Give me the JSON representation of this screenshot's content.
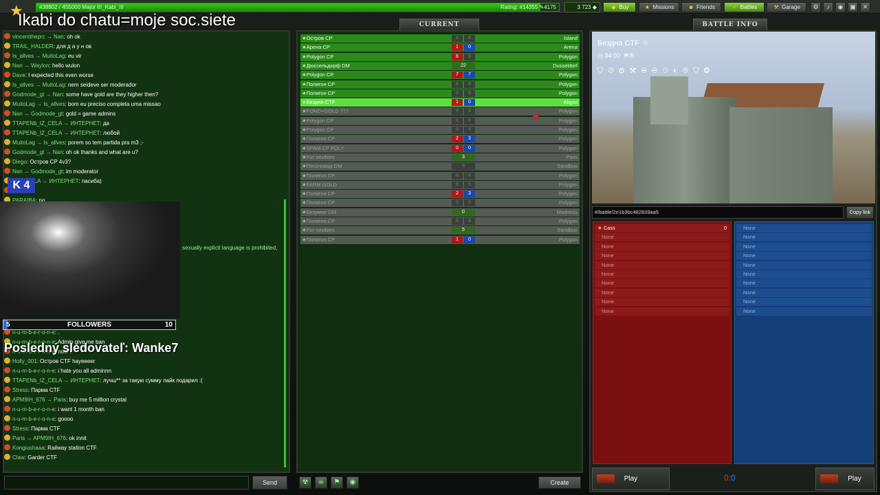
{
  "topbar": {
    "xp_text": "438802 / 455000  Major III_Kabi_III",
    "xp_progress": 0.964,
    "rating": "Rating: #14355  ✎4175",
    "crystals": "3 723",
    "buy": "Buy",
    "missions": "Missions",
    "friends": "Friends",
    "battles": "Battles",
    "garage": "Garage"
  },
  "stream": {
    "title": "Ikabi do chatu=moje soc.siete",
    "k_badge": "4",
    "followers_label": "FOLLOWERS",
    "followers_left": "5",
    "followers_right": "10",
    "last_follower": "Posledný sledovateľ: Wanke7"
  },
  "chat": {
    "lines": [
      {
        "nick": "vincenttheprc",
        "to": "Nan",
        "text": "oh ok"
      },
      {
        "nick": "TRAIL_HALDER",
        "to": "",
        "text": "для д а у н ов"
      },
      {
        "nick": "Is_allves",
        "to": "MuitoLag",
        "text": "eu vir"
      },
      {
        "nick": "Nan",
        "to": "Waylon",
        "text": "hello wulon"
      },
      {
        "nick": "Dave",
        "to": "",
        "text": "I expected this even worse"
      },
      {
        "nick": "Is_allves",
        "to": "MuitoLag",
        "text": "nem seideve ser moderador"
      },
      {
        "nick": "Godmode_gt",
        "to": "Nan",
        "text": "some have gold are they higher then?"
      },
      {
        "nick": "MuitoLag",
        "to": "Is_allves",
        "text": "bom eu preciso completa uma missao"
      },
      {
        "nick": "Nan",
        "to": "Godmode_gt",
        "text": "gold = game admins"
      },
      {
        "nick": "TTAPENb_IZ_CELA",
        "to": "ИНТЕРНЕТ",
        "text": "да"
      },
      {
        "nick": "TTAPENb_IZ_CELA",
        "to": "ИНТЕРНЕТ",
        "text": "любой"
      },
      {
        "nick": "MuitoLag",
        "to": "Is_allves",
        "text": "porem so tem partida pra m3 ;-"
      },
      {
        "nick": "Godmode_gt",
        "to": "Nan",
        "text": "oh ok thanks and what are u?"
      },
      {
        "nick": "Diego",
        "to": "",
        "text": "Остров CP 4v3?"
      },
      {
        "nick": "Nan",
        "to": "Godmode_gt",
        "text": "im moderator"
      },
      {
        "nick": "b_IZ_CELA",
        "to": "ИНТЕРНЕТ",
        "text": "пасиба)"
      },
      {
        "nick": "A",
        "to": "",
        "text": "brasil"
      },
      {
        "nick": "PARAIBA",
        "to": "",
        "text": "no"
      }
    ],
    "lines2": [
      {
        "nick": "n-u-m-b-e-r-o-n-e",
        "to": "",
        "text": "."
      },
      {
        "nick": "n-u-m-b-e-r-o-n-e",
        "to": "",
        "text": "Admin give me ban"
      },
      {
        "nick": "n-u-m-b-e-r-o-n-e",
        "to": "",
        "text": "now !!"
      },
      {
        "nick": "Holly_001",
        "to": "",
        "text": "Остров CTF hayeeeer"
      },
      {
        "nick": "n-u-m-b-e-r-o-n-e",
        "to": "",
        "text": "i hate you all adminnn"
      },
      {
        "nick": "TTAPENb_IZ_CELA",
        "to": "ИНТЕРНЕТ",
        "text": "лучш** за такую сумму лайк подарил :("
      },
      {
        "nick": "Stress",
        "to": "",
        "text": "Парма CTF"
      },
      {
        "nick": "APM9IH_676",
        "to": "Paris",
        "text": "buy me 5 million crystal"
      },
      {
        "nick": "n-u-m-b-e-r-o-n-e",
        "to": "",
        "text": "i want 1 month ban"
      },
      {
        "nick": "n-u-m-b-e-r-o-n-e",
        "to": "",
        "text": "goooo"
      },
      {
        "nick": "Stress",
        "to": "",
        "text": "Парма CTF"
      },
      {
        "nick": "Paris",
        "to": "APM9IH_676",
        "text": "ok innit"
      },
      {
        "nick": "Kongiushaaa",
        "to": "",
        "text": "Railway station CTF"
      },
      {
        "nick": "Claw",
        "to": "",
        "text": "Garder CTF"
      }
    ],
    "warning": "sexually explicit language is prohibited,",
    "send": "Send"
  },
  "battles": {
    "header": "CURRENT BATTLES",
    "create": "Create",
    "rows": [
      {
        "name": "Остров CP",
        "red": "8",
        "blue": "8",
        "map": "Island",
        "active": true,
        "redlit": false,
        "bluelit": false
      },
      {
        "name": "Арена CP",
        "red": "1",
        "blue": "0",
        "map": "Arena",
        "active": true,
        "redlit": true,
        "bluelit": true
      },
      {
        "name": "Polygon CP",
        "red": "6",
        "blue": "8",
        "map": "Polygon",
        "active": true,
        "redlit": true,
        "bluelit": false
      },
      {
        "name": "Дюссельдорф DM",
        "red": "22",
        "blue": "",
        "map": "Dusseldorf",
        "active": true,
        "dm": true
      },
      {
        "name": "Polygon CP",
        "red": "7",
        "blue": "7",
        "map": "Polygon",
        "active": true,
        "redlit": true,
        "bluelit": true
      },
      {
        "name": "Полигон CP",
        "red": "8",
        "blue": "8",
        "map": "Polygon",
        "active": true,
        "redlit": false,
        "bluelit": false
      },
      {
        "name": "Полигон CP",
        "red": "8",
        "blue": "8",
        "map": "Polygon",
        "active": true,
        "redlit": false,
        "bluelit": false
      },
      {
        "name": "Бездна CTF",
        "red": "1",
        "blue": "0",
        "map": "Abyss",
        "active": true,
        "selected": true,
        "redlit": true,
        "bluelit": true
      },
      {
        "name": "FOND+GOLD 777",
        "red": "8",
        "blue": "8",
        "map": "Polygon",
        "active": false
      },
      {
        "name": "Polygon CP",
        "red": "8",
        "blue": "8",
        "map": "Polygon",
        "active": false
      },
      {
        "name": "Polygon CP",
        "red": "8",
        "blue": "8",
        "map": "Polygon",
        "active": false
      },
      {
        "name": "Полигон CP",
        "red": "2",
        "blue": "3",
        "map": "Polygon",
        "active": false,
        "redlit": true,
        "bluelit": true
      },
      {
        "name": "SPAM CP POLY",
        "red": "0",
        "blue": "0",
        "map": "Polygon",
        "active": false,
        "redlit": true,
        "bluelit": true
      },
      {
        "name": "For newbies",
        "red": "3",
        "blue": "",
        "map": "Pass",
        "active": false,
        "dm": true,
        "dmlit": true
      },
      {
        "name": "Песочница DM",
        "red": "8",
        "blue": "",
        "map": "Sandbox",
        "active": false,
        "dm": true
      },
      {
        "name": "Полигон CP",
        "red": "8",
        "blue": "8",
        "map": "Polygon",
        "active": false
      },
      {
        "name": "FARM GOLD",
        "red": "8",
        "blue": "8",
        "map": "Polygon",
        "active": false
      },
      {
        "name": "Полигон CP",
        "red": "2",
        "blue": "3",
        "map": "Polygon",
        "active": false,
        "redlit": true,
        "bluelit": true
      },
      {
        "name": "Полигон CP",
        "red": "8",
        "blue": "8",
        "map": "Polygon",
        "active": false
      },
      {
        "name": "Безумие DM",
        "red": "0",
        "blue": "",
        "map": "Madness",
        "active": false,
        "dm": true,
        "dmlit": true
      },
      {
        "name": "Полигон CP",
        "red": "8",
        "blue": "8",
        "map": "Polygon",
        "active": false
      },
      {
        "name": "For newbies",
        "red": "5",
        "blue": "",
        "map": "Sandbox",
        "active": false,
        "dm": true,
        "dmlit": true
      },
      {
        "name": "Полигон CP",
        "red": "1",
        "blue": "0",
        "map": "Polygon",
        "active": false,
        "redlit": true,
        "bluelit": true
      }
    ]
  },
  "info": {
    "header": "BATTLE INFO",
    "map_name": "Бездна CTF",
    "time": "34:00",
    "flags": "5",
    "link": "#/battle/2e1b3bc482839aa5",
    "copy": "Copy link",
    "red_players": [
      {
        "name": "Cass",
        "score": "0"
      },
      {
        "name": "None"
      },
      {
        "name": "None"
      },
      {
        "name": "None"
      },
      {
        "name": "None"
      },
      {
        "name": "None"
      },
      {
        "name": "None"
      },
      {
        "name": "None"
      },
      {
        "name": "None"
      },
      {
        "name": "None"
      }
    ],
    "blue_players": [
      "None",
      "None",
      "None",
      "None",
      "None",
      "None",
      "None",
      "None",
      "None",
      "None"
    ],
    "play_red": "Play",
    "play_blue": "Play",
    "score_red": "0",
    "score_sep": ":",
    "score_blue": "0"
  }
}
